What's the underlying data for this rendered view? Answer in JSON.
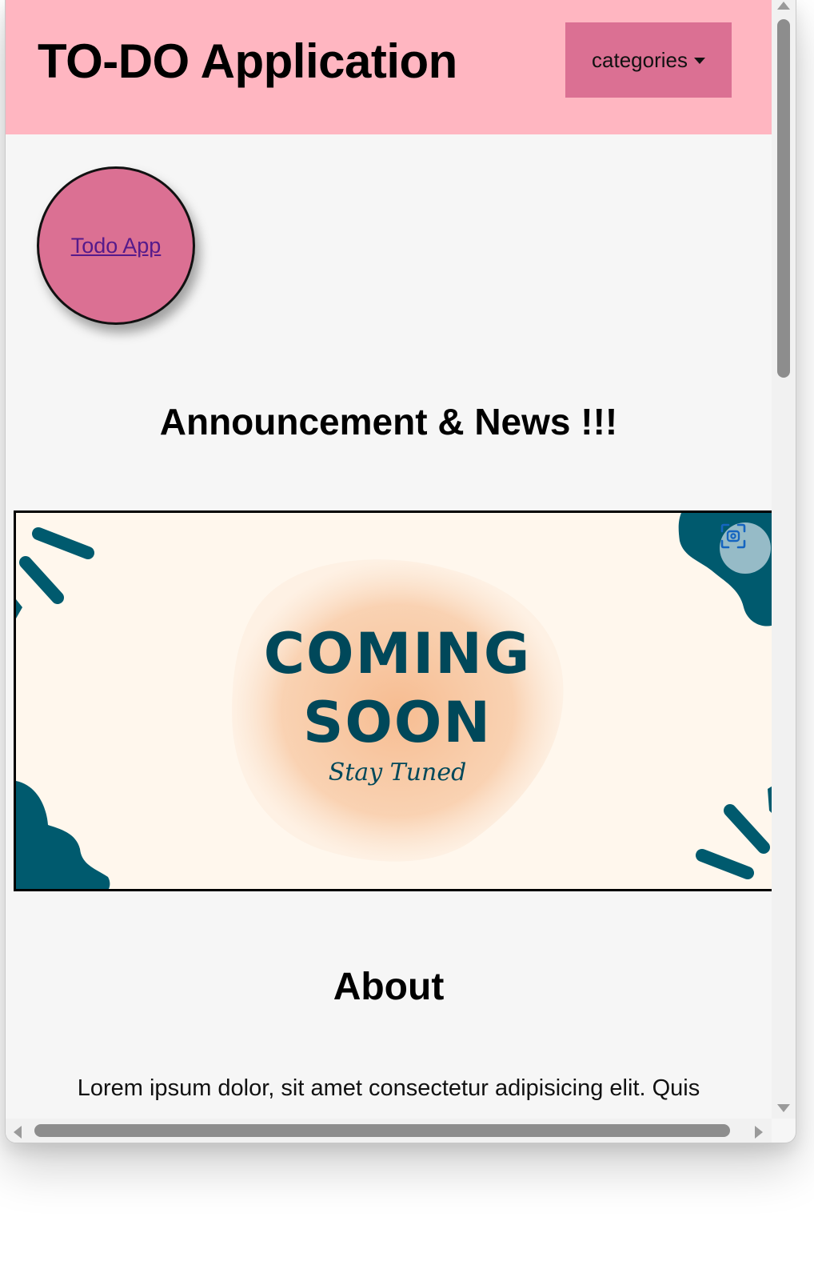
{
  "header": {
    "title": "TO-DO Application",
    "categories_label": "categories"
  },
  "todo_link": {
    "label": "Todo App"
  },
  "news": {
    "title": "Announcement & News !!!",
    "banner": {
      "headline_line1": "COMING",
      "headline_line2": "SOON",
      "tagline": "Stay Tuned",
      "lens_icon": "visual-search-icon"
    }
  },
  "about": {
    "title": "About",
    "text": "Lorem ipsum dolor, sit amet consectetur adipisicing elit. Quis"
  },
  "colors": {
    "header_bg": "#ffb6c1",
    "accent": "#db7093",
    "banner_bg": "#fff7ed",
    "banner_teal": "#005a6e",
    "banner_peach": "#f6b98c",
    "page_bg": "#f6f6f6"
  }
}
